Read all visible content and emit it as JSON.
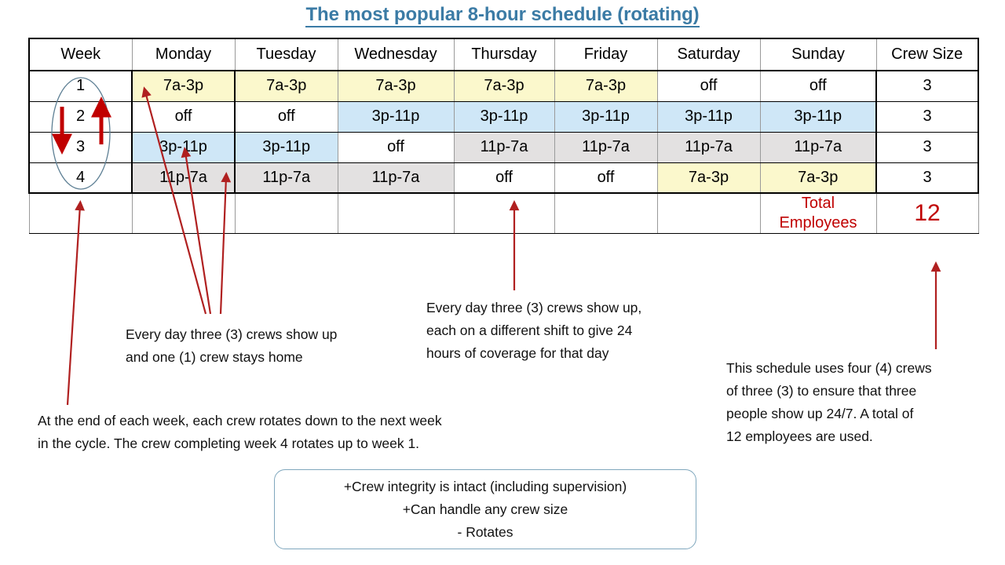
{
  "title": "The most popular 8-hour schedule (rotating)",
  "table": {
    "headers": [
      "Week",
      "Monday",
      "Tuesday",
      "Wednesday",
      "Thursday",
      "Friday",
      "Saturday",
      "Sunday",
      "Crew Size"
    ],
    "rows": [
      {
        "week": "1",
        "cells": [
          {
            "text": "7a-3p",
            "fill": "yellow"
          },
          {
            "text": "7a-3p",
            "fill": "yellow"
          },
          {
            "text": "7a-3p",
            "fill": "yellow"
          },
          {
            "text": "7a-3p",
            "fill": "yellow"
          },
          {
            "text": "7a-3p",
            "fill": "yellow"
          },
          {
            "text": "off",
            "fill": "white"
          },
          {
            "text": "off",
            "fill": "white"
          }
        ],
        "crew_size": "3"
      },
      {
        "week": "2",
        "cells": [
          {
            "text": "off",
            "fill": "white"
          },
          {
            "text": "off",
            "fill": "white"
          },
          {
            "text": "3p-11p",
            "fill": "blue"
          },
          {
            "text": "3p-11p",
            "fill": "blue"
          },
          {
            "text": "3p-11p",
            "fill": "blue"
          },
          {
            "text": "3p-11p",
            "fill": "blue"
          },
          {
            "text": "3p-11p",
            "fill": "blue"
          }
        ],
        "crew_size": "3"
      },
      {
        "week": "3",
        "cells": [
          {
            "text": "3p-11p",
            "fill": "blue"
          },
          {
            "text": "3p-11p",
            "fill": "blue"
          },
          {
            "text": "off",
            "fill": "white"
          },
          {
            "text": "11p-7a",
            "fill": "gray"
          },
          {
            "text": "11p-7a",
            "fill": "gray"
          },
          {
            "text": "11p-7a",
            "fill": "gray"
          },
          {
            "text": "11p-7a",
            "fill": "gray"
          }
        ],
        "crew_size": "3"
      },
      {
        "week": "4",
        "cells": [
          {
            "text": "11p-7a",
            "fill": "gray"
          },
          {
            "text": "11p-7a",
            "fill": "gray"
          },
          {
            "text": "11p-7a",
            "fill": "gray"
          },
          {
            "text": "off",
            "fill": "white"
          },
          {
            "text": "off",
            "fill": "white"
          },
          {
            "text": "7a-3p",
            "fill": "yellow"
          },
          {
            "text": "7a-3p",
            "fill": "yellow"
          }
        ],
        "crew_size": "3"
      }
    ],
    "footer": {
      "total_label_line1": "Total",
      "total_label_line2": "Employees",
      "total_value": "12"
    }
  },
  "notes": {
    "crews": "Every day three (3) crews show up\nand one (1) crew stays home",
    "shifts": "Every day three (3) crews show up,\neach on a different shift to give 24\nhours of coverage for that day",
    "uses": "This schedule uses  four (4) crews\nof three (3) to ensure that three\npeople show up 24/7.  A total of\n12 employees are used.",
    "rotate": "At the end of each week, each crew rotates down to the next week\n in the cycle.  The crew completing week 4 rotates up to week 1."
  },
  "pros_box": {
    "line1": "+Crew integrity is intact (including supervision)",
    "line2": "+Can handle any crew size",
    "line3": "- Rotates"
  },
  "colors": {
    "title": "#3b7ba5",
    "accent_red": "#c00000",
    "arrow_red": "#b02020",
    "shift_day": "#fbf8cc",
    "shift_evening": "#cfe7f7",
    "shift_night": "#e3e1e1",
    "callout_border": "#7fa7bd"
  }
}
